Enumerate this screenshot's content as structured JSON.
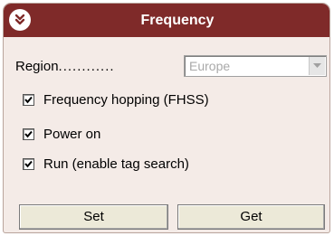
{
  "panel": {
    "title": "Frequency",
    "collapse_icon": "double-chevron-down-icon"
  },
  "region": {
    "label": "Region",
    "leader": "............",
    "selected": "Europe"
  },
  "options": [
    {
      "label": "Frequency hopping (FHSS)",
      "checked": true
    },
    {
      "label": "Power on",
      "checked": true
    },
    {
      "label": "Run (enable tag search)",
      "checked": true
    }
  ],
  "buttons": {
    "set": "Set",
    "get": "Get"
  },
  "colors": {
    "title_bar": "#7f2a29",
    "panel_bg": "#f4ebe7"
  }
}
